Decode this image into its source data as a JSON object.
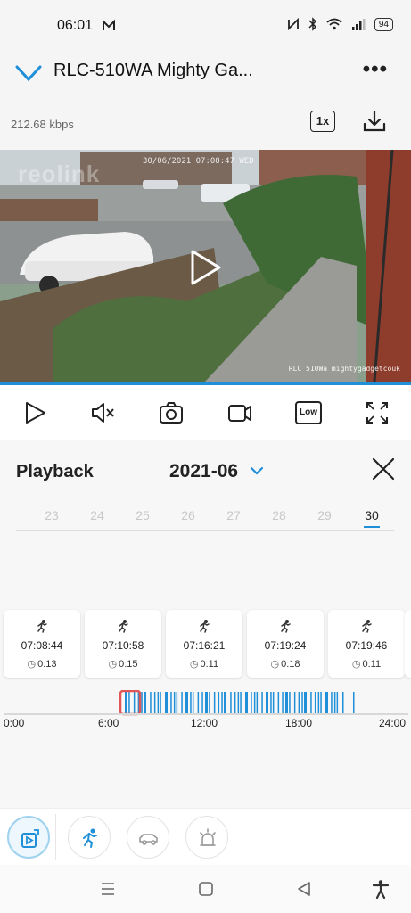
{
  "status_bar": {
    "time": "06:01",
    "battery": "94",
    "icons": [
      "gmail-icon",
      "nfc-icon",
      "bluetooth-icon",
      "wifi-icon",
      "signal-icon",
      "battery-icon"
    ]
  },
  "header": {
    "title": "RLC-510WA Mighty Ga...",
    "back_icon": "chevron-down-icon",
    "more_label": "•••"
  },
  "stream": {
    "bitrate": "212.68 kbps",
    "speed_label": "1x"
  },
  "video": {
    "watermark": "reolink",
    "osd_datetime": "30/06/2021 07:08:47 WED",
    "osd_camera": "RLC 510Wa mightygadgetcouk"
  },
  "controls": {
    "items": [
      "play-icon",
      "mute-icon",
      "snapshot-icon",
      "record-icon",
      "quality-low-icon",
      "fullscreen-icon"
    ],
    "quality_label": "Low"
  },
  "playback": {
    "label": "Playback",
    "month": "2021-06",
    "days": [
      "23",
      "24",
      "25",
      "26",
      "27",
      "28",
      "29",
      "30"
    ],
    "selected_day": "30"
  },
  "clips": [
    {
      "time": "07:08:44",
      "duration": "0:13"
    },
    {
      "time": "07:10:58",
      "duration": "0:15"
    },
    {
      "time": "07:16:21",
      "duration": "0:11"
    },
    {
      "time": "07:19:24",
      "duration": "0:18"
    },
    {
      "time": "07:19:46",
      "duration": "0:11"
    }
  ],
  "timeline": {
    "labels": [
      "0:00",
      "6:00",
      "12:00",
      "18:00",
      "24:00"
    ],
    "accent": "#1e8fd8",
    "marker_color": "#e05656"
  },
  "filters": {
    "items": [
      "all-events-icon",
      "person-icon",
      "vehicle-icon",
      "alarm-icon"
    ],
    "active": "all-events-icon"
  },
  "colors": {
    "accent": "#1e8fd8",
    "background": "#f7f7f7"
  }
}
